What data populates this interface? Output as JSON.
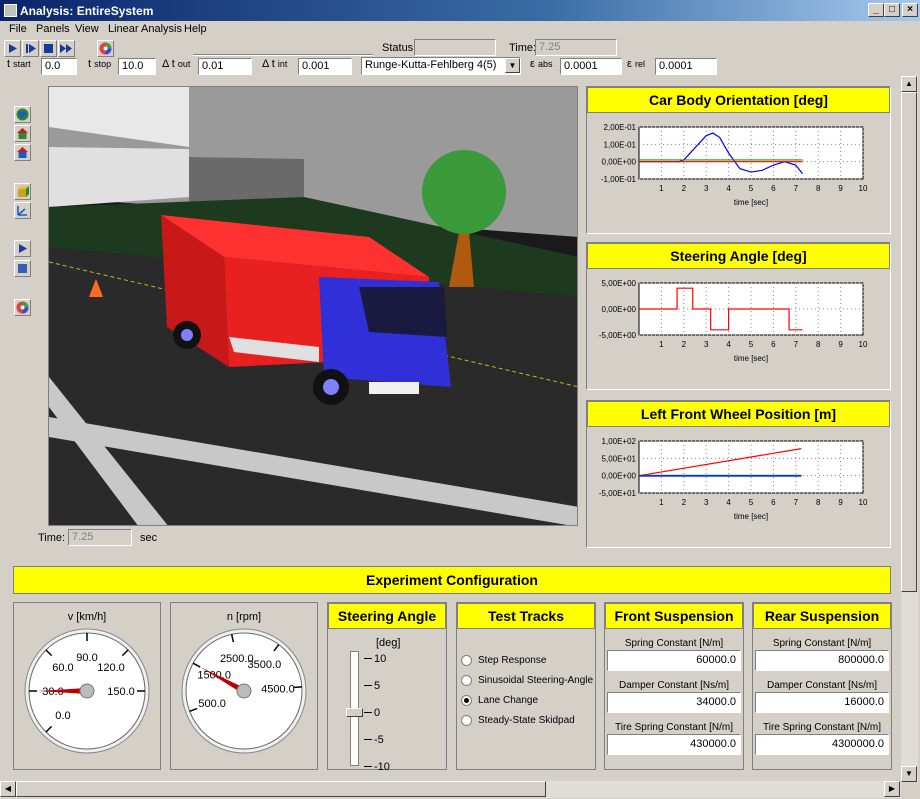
{
  "window": {
    "title": "Analysis: EntireSystem"
  },
  "menu": [
    "File",
    "Panels",
    "View",
    "Linear Analysis",
    "Help"
  ],
  "toolbar": {
    "status_label": "Status:",
    "status_value": "",
    "time_label": "Time:",
    "time_value": "7.25",
    "tstart_label": "t",
    "tstart_sub": "start",
    "tstart_value": "0.0",
    "tstop_label": "t",
    "tstop_sub": "stop",
    "tstop_value": "10.0",
    "dtout_label": "Δ t",
    "dtout_sub": "out",
    "dtout_value": "0.01",
    "dtint_label": "Δ t",
    "dtint_sub": "int",
    "dtint_value": "0.001",
    "solver": "Runge-Kutta-Fehlberg 4(5)",
    "eabs_label": "ε",
    "eabs_sub": "abs",
    "eabs_value": "0.0001",
    "erel_label": "ε",
    "erel_sub": "rel",
    "erel_value": "0.0001"
  },
  "view": {
    "time_label": "Time:",
    "time_value": "7.25",
    "unit": "sec"
  },
  "chart_data": [
    {
      "type": "line",
      "title": "Car Body Orientation [deg]",
      "xlabel": "time [sec]",
      "yticks": [
        "2,00E-01",
        "1,00E-01",
        "0,00E+00",
        "-1,00E-01"
      ],
      "xticks": [
        "1",
        "2",
        "3",
        "4",
        "5",
        "6",
        "7",
        "8",
        "9",
        "10"
      ],
      "xlim": [
        0,
        10
      ],
      "ylim": [
        -0.1,
        0.2
      ],
      "series": [
        {
          "color": "#0000ff",
          "x": [
            0,
            1.8,
            2.0,
            2.5,
            3.0,
            3.3,
            3.6,
            4.0,
            4.5,
            5.0,
            5.5,
            6.0,
            6.5,
            7.0,
            7.3
          ],
          "y": [
            0,
            0,
            0.01,
            0.08,
            0.15,
            0.165,
            0.14,
            0.05,
            -0.04,
            -0.06,
            -0.05,
            -0.02,
            0,
            -0.02,
            -0.07
          ]
        },
        {
          "color": "#00aa00",
          "x": [
            0,
            7.3
          ],
          "y": [
            0.01,
            0.01
          ]
        },
        {
          "color": "#ff0000",
          "x": [
            0,
            7.3
          ],
          "y": [
            0,
            0
          ]
        }
      ]
    },
    {
      "type": "line",
      "title": "Steering Angle [deg]",
      "xlabel": "time [sec]",
      "yticks": [
        "5,00E+00",
        "0,00E+00",
        "-5,00E+00"
      ],
      "xticks": [
        "1",
        "2",
        "3",
        "4",
        "5",
        "6",
        "7",
        "8",
        "9",
        "10"
      ],
      "xlim": [
        0,
        10
      ],
      "ylim": [
        -5,
        5
      ],
      "series": [
        {
          "color": "#ff0000",
          "x": [
            0,
            1.7,
            1.7,
            2.4,
            2.4,
            3.2,
            3.2,
            4.0,
            4.0,
            6.7,
            6.7,
            7.3
          ],
          "y": [
            0,
            0,
            4,
            4,
            0,
            0,
            -4,
            -4,
            0,
            0,
            -4,
            -4
          ]
        }
      ]
    },
    {
      "type": "line",
      "title": "Left Front Wheel Position [m]",
      "xlabel": "time [sec]",
      "yticks": [
        "1,00E+02",
        "5,00E+01",
        "0,00E+00",
        "-5,00E+01"
      ],
      "xticks": [
        "1",
        "2",
        "3",
        "4",
        "5",
        "6",
        "7",
        "8",
        "9",
        "10"
      ],
      "xlim": [
        0,
        10
      ],
      "ylim": [
        -50,
        100
      ],
      "series": [
        {
          "color": "#ff0000",
          "x": [
            0,
            7.25
          ],
          "y": [
            0,
            78
          ]
        },
        {
          "color": "#00aa00",
          "x": [
            0,
            7.25
          ],
          "y": [
            1,
            1
          ]
        },
        {
          "color": "#0000ff",
          "x": [
            0,
            7.25
          ],
          "y": [
            -1,
            -1
          ]
        }
      ]
    }
  ],
  "experiment": {
    "title": "Experiment Configuration",
    "gauge_v": {
      "label": "v [km/h]",
      "ticks": [
        "0.0",
        "30.0",
        "60.0",
        "90.0",
        "120.0",
        "150.0"
      ],
      "value": 30
    },
    "gauge_n": {
      "label": "n [rpm]",
      "ticks": [
        "500.0",
        "1500.0",
        "2500.0",
        "3500.0",
        "4500.0"
      ],
      "value": 1500
    },
    "steering": {
      "title": "Steering Angle",
      "unit": "[deg]",
      "ticks": [
        "10",
        "5",
        "0",
        "-5",
        "-10"
      ],
      "value": 0
    },
    "tracks": {
      "title": "Test Tracks",
      "options": [
        "Step Response",
        "Sinusoidal Steering-Angle",
        "Lane Change",
        "Steady-State Skidpad"
      ],
      "selected": 2
    },
    "front": {
      "title": "Front Suspension",
      "spring_label": "Spring Constant [N/m]",
      "spring": "60000.0",
      "damper_label": "Damper Constant [Ns/m]",
      "damper": "34000.0",
      "tire_label": "Tire Spring Constant [N/m]",
      "tire": "430000.0"
    },
    "rear": {
      "title": "Rear Suspension",
      "spring_label": "Spring Constant [N/m]",
      "spring": "800000.0",
      "damper_label": "Damper Constant [Ns/m]",
      "damper": "16000.0",
      "tire_label": "Tire Spring Constant [N/m]",
      "tire": "4300000.0"
    }
  },
  "colors": {
    "header": "#ffff00",
    "truck_body": "#e02020",
    "truck_cab": "#2a2ae0"
  }
}
